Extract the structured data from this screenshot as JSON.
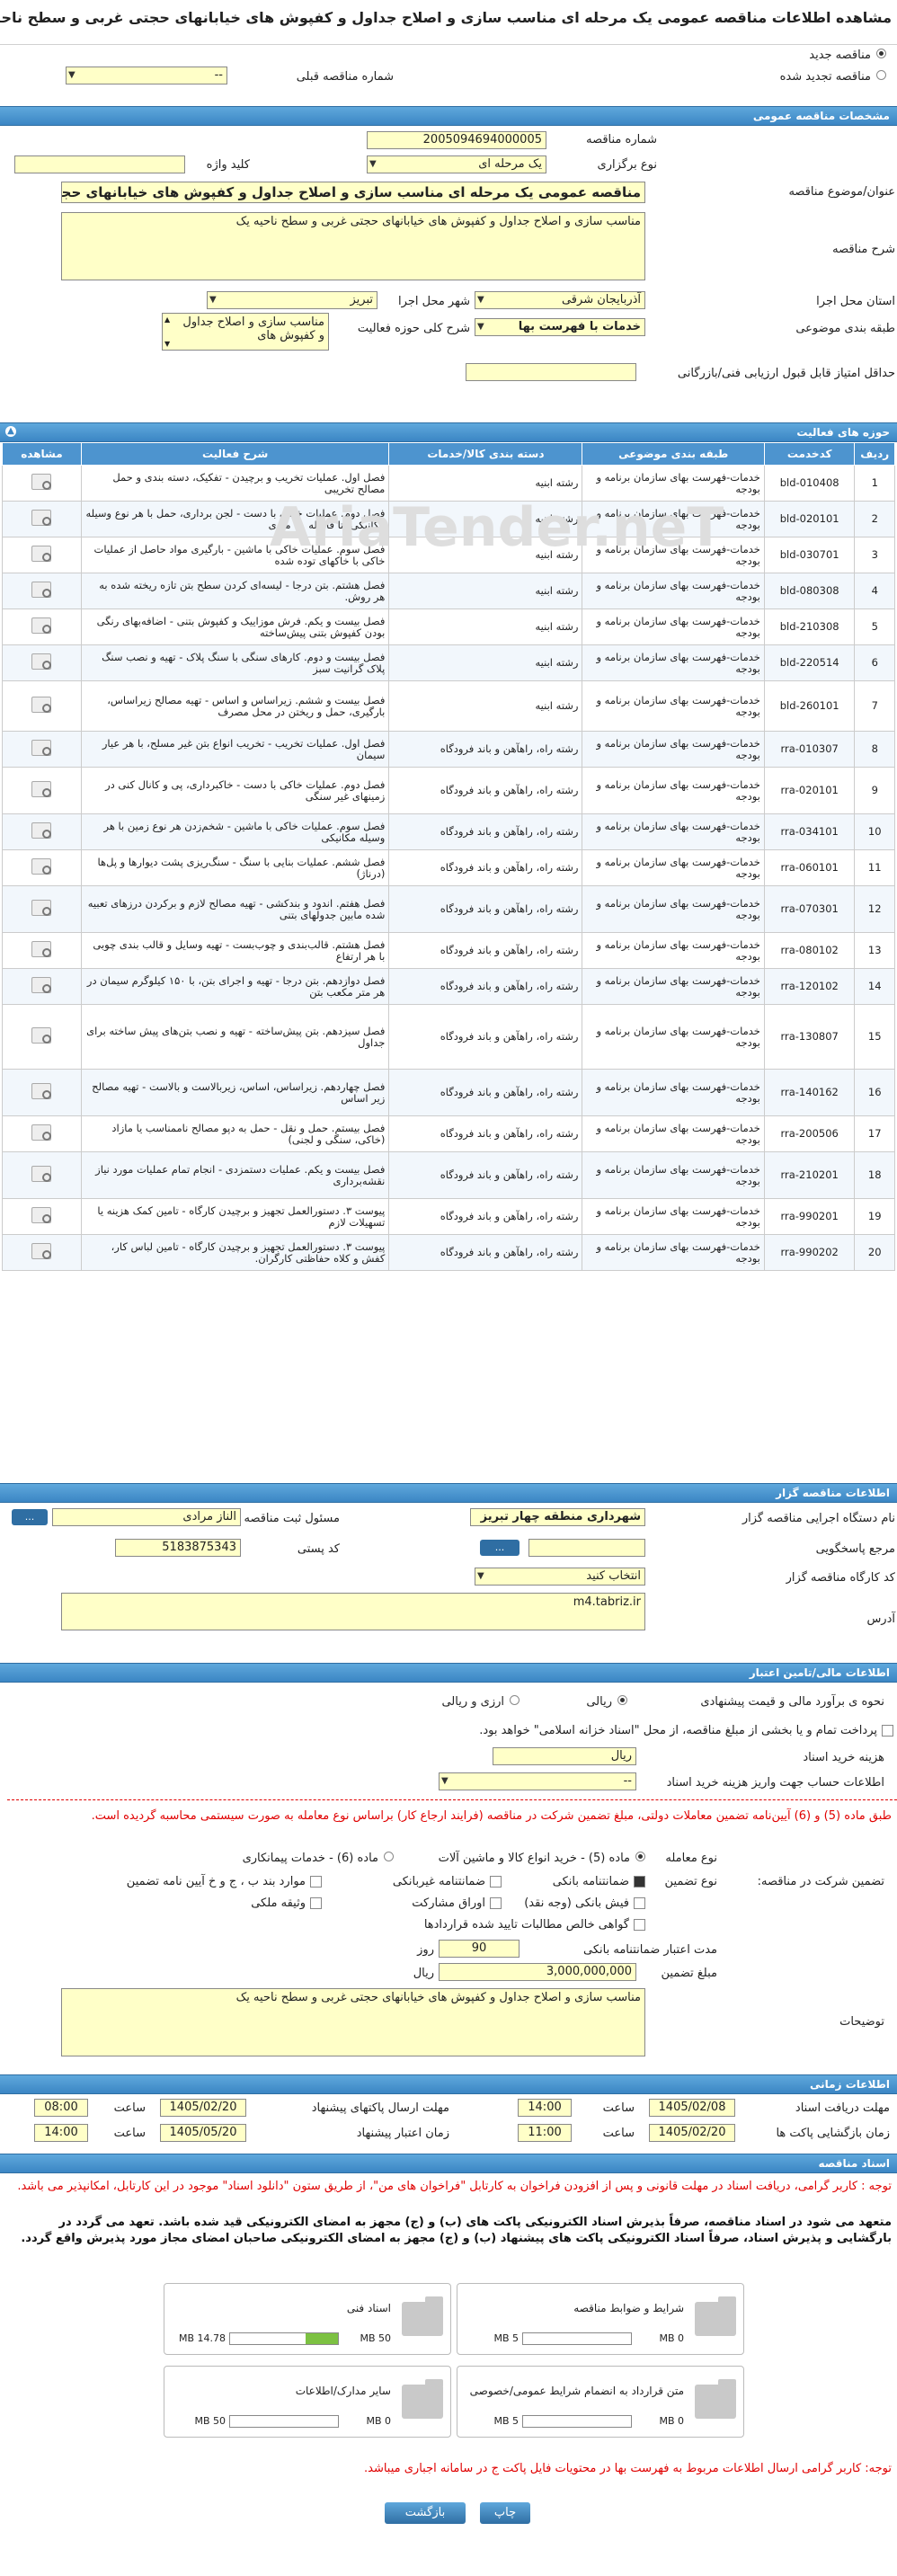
{
  "page": {
    "title": "مشاهده اطلاعات مناقصه عمومی یک مرحله ای مناسب سازی و اصلاح جداول و کفپوش های خیابانهای حجتی غربی و سطح ناحیه یک",
    "radio_new": "مناقصه جدید",
    "radio_renewed": "مناقصه تجدید شده",
    "prev_label": "شماره مناقصه قبلی",
    "prev_value": "--"
  },
  "specs": {
    "section": "مشخصات مناقصه عمومی",
    "number_label": "شماره مناقصه",
    "number_value": "2005094694000005",
    "type_label": "نوع برگزاری",
    "type_value": "یک مرحله ای",
    "keyword_label": "کلید واژه",
    "subject_label": "عنوان/موضوع مناقصه",
    "subject_value": "مناقصه عمومی یک مرحله ای مناسب سازی و اصلاح جداول و کفپوش های خیابانهای حجتی غربی و سطح ناحیه یک",
    "desc_label": "شرح مناقصه",
    "desc_value": "مناسب سازی و اصلاح جداول و کفپوش های خیابانهای حجتی غربی و سطح ناحیه یک",
    "province_label": "استان محل اجرا",
    "province_value": "آذربایجان شرقی",
    "city_label": "شهر محل اجرا",
    "city_value": "تبریز",
    "class_label": "طبقه بندی موضوعی",
    "class_value": "خدمات با فهرست بها",
    "scope_label": "شرح کلی حوزه فعالیت",
    "scope_value": "مناسب سازی و اصلاح جداول و کفپوش های",
    "score_label": "حداقل امتیاز قابل قبول ارزیابی فنی/بازرگانی"
  },
  "activities": {
    "section": "حوزه های فعالیت",
    "headers": [
      "ردیف",
      "کدخدمت",
      "طبقه بندی موضوعی",
      "دسته بندی کالا/خدمات",
      "شرح فعالیت",
      "مشاهده"
    ],
    "rows": [
      {
        "n": "1",
        "code": "bld-010408",
        "cat": "خدمات-فهرست بهای سازمان برنامه و بودجه",
        "grp": "رشته ابنیه",
        "desc": "فصل اول. عملیات تخریب و برچیدن - تفکیک، دسته بندی و حمل مصالح تخریبی"
      },
      {
        "n": "2",
        "code": "bld-020101",
        "cat": "خدمات-فهرست بهای سازمان برنامه و بودجه",
        "grp": "رشته ابنیه",
        "desc": "فصل دوم. عملیات خاکی با دست - لجن برداری، حمل با هر نوع وسیله مکانیکی، تا فاصله ۵۰ متری"
      },
      {
        "n": "3",
        "code": "bld-030701",
        "cat": "خدمات-فهرست بهای سازمان برنامه و بودجه",
        "grp": "رشته ابنیه",
        "desc": "فصل سوم. عملیات خاکی با ماشین - بارگیری مواد حاصل از عملیات خاکی با خاکهای توده شده"
      },
      {
        "n": "4",
        "code": "bld-080308",
        "cat": "خدمات-فهرست بهای سازمان برنامه و بودجه",
        "grp": "رشته ابنیه",
        "desc": "فصل هشتم. بتن درجا - لیسه‌ای کردن سطح بتن تازه ریخته شده به هر روش."
      },
      {
        "n": "5",
        "code": "bld-210308",
        "cat": "خدمات-فهرست بهای سازمان برنامه و بودجه",
        "grp": "رشته ابنیه",
        "desc": "فصل بیست و یکم. فرش موزاییک و کفپوش بتنی - اضافه‌بهای رنگی بودن کفپوش بتنی پیش‌ساخته"
      },
      {
        "n": "6",
        "code": "bld-220514",
        "cat": "خدمات-فهرست بهای سازمان برنامه و بودجه",
        "grp": "رشته ابنیه",
        "desc": "فصل بیست و دوم. کارهای سنگی با سنگ پلاک - تهیه و نصب سنگ پلاک گرانیت سبز"
      },
      {
        "n": "7",
        "code": "bld-260101",
        "cat": "خدمات-فهرست بهای سازمان برنامه و بودجه",
        "grp": "رشته ابنیه",
        "desc": "فصل بیست و ششم. زیراساس و اساس - تهیه مصالح زیراساس، بارگیری، حمل و ریختن در محل مصرف"
      },
      {
        "n": "8",
        "code": "rra-010307",
        "cat": "خدمات-فهرست بهای سازمان برنامه و بودجه",
        "grp": "رشته راه، راهآهن و باند فرودگاه",
        "desc": "فصل اول. عملیات تخریب - تخریب انواع بتن غیر مسلح، با هر عیار سیمان"
      },
      {
        "n": "9",
        "code": "rra-020101",
        "cat": "خدمات-فهرست بهای سازمان برنامه و بودجه",
        "grp": "رشته راه، راهآهن و باند فرودگاه",
        "desc": "فصل دوم. عملیات خاکی با دست - خاکبرداری، پی و کانال کنی در زمینهای غیر سنگی"
      },
      {
        "n": "10",
        "code": "rra-034101",
        "cat": "خدمات-فهرست بهای سازمان برنامه و بودجه",
        "grp": "رشته راه، راهآهن و باند فرودگاه",
        "desc": "فصل سوم. عملیات خاکی با ماشین - شخم‌زدن هر نوع زمین با هر وسیله مکانیکی"
      },
      {
        "n": "11",
        "code": "rra-060101",
        "cat": "خدمات-فهرست بهای سازمان برنامه و بودجه",
        "grp": "رشته راه، راهآهن و باند فرودگاه",
        "desc": "فصل ششم. عملیات بنایی با سنگ - سنگ‌ریزی پشت دیوارها و پل‌ها (درناژ)"
      },
      {
        "n": "12",
        "code": "rra-070301",
        "cat": "خدمات-فهرست بهای سازمان برنامه و بودجه",
        "grp": "رشته راه، راهآهن و باند فرودگاه",
        "desc": "فصل هفتم. اندود و بندکشی - تهیه مصالح لازم و برکردن درزهای تعبیه شده مابین جدولهای بتنی"
      },
      {
        "n": "13",
        "code": "rra-080102",
        "cat": "خدمات-فهرست بهای سازمان برنامه و بودجه",
        "grp": "رشته راه، راهآهن و باند فرودگاه",
        "desc": "فصل هشتم. قالب‌بندی و چوب‌بست - تهیه وسایل و قالب بندی چوبی با هر ارتفاع"
      },
      {
        "n": "14",
        "code": "rra-120102",
        "cat": "خدمات-فهرست بهای سازمان برنامه و بودجه",
        "grp": "رشته راه، راهآهن و باند فرودگاه",
        "desc": "فصل دوازدهم. بتن درجا - تهیه و اجرای بتن، با ۱۵۰ کیلوگرم سیمان در هر متر مکعب بتن"
      },
      {
        "n": "15",
        "code": "rra-130807",
        "cat": "خدمات-فهرست بهای سازمان برنامه و بودجه",
        "grp": "رشته راه، راهآهن و باند فرودگاه",
        "desc": "فصل سیزدهم. بتن پیش‌ساخته - تهیه و نصب بتن‌های پیش ساخته برای جداول"
      },
      {
        "n": "16",
        "code": "rra-140162",
        "cat": "خدمات-فهرست بهای سازمان برنامه و بودجه",
        "grp": "رشته راه، راهآهن و باند فرودگاه",
        "desc": "فصل چهاردهم. زیراساس، اساس، زیربالاست و بالاست - تهیه مصالح زیر اساس"
      },
      {
        "n": "17",
        "code": "rra-200506",
        "cat": "خدمات-فهرست بهای سازمان برنامه و بودجه",
        "grp": "رشته راه، راهآهن و باند فرودگاه",
        "desc": "فصل بیستم. حمل و نقل - حمل به دپو مصالح ناممناسب یا مازاد (خاکی، سنگی و لجنی)"
      },
      {
        "n": "18",
        "code": "rra-210201",
        "cat": "خدمات-فهرست بهای سازمان برنامه و بودجه",
        "grp": "رشته راه، راهآهن و باند فرودگاه",
        "desc": "فصل بیست و یکم. عملیات دستمزدی - انجام تمام عملیات مورد نیاز نقشه‌برداری"
      },
      {
        "n": "19",
        "code": "rra-990201",
        "cat": "خدمات-فهرست بهای سازمان برنامه و بودجه",
        "grp": "رشته راه، راهآهن و باند فرودگاه",
        "desc": "پیوست ۳. دستورالعمل تجهیز و برچیدن کارگاه - تامین کمک هزینه یا تسهیلات لازم"
      },
      {
        "n": "20",
        "code": "rra-990202",
        "cat": "خدمات-فهرست بهای سازمان برنامه و بودجه",
        "grp": "رشته راه، راهآهن و باند فرودگاه",
        "desc": "پیوست ۳. دستورالعمل تجهیز و برچیدن کارگاه - تامین لباس کار، کفش و کلاه حفاظتی کارگران."
      }
    ]
  },
  "org": {
    "section": "اطلاعات مناقصه گزار",
    "name_label": "نام دستگاه اجرایی مناقصه گزار",
    "name_value": "شهرداری منطقه چهار تبریز",
    "person_label": "مسئول ثبت مناقصه",
    "person_value": "الناز مرادی",
    "ref_label": "مرجع پاسخگویی",
    "postal_label": "کد پستی",
    "postal_value": "5183875343",
    "workshop_label": "کد کارگاه مناقصه گزار",
    "workshop_value": "انتخاب کنید",
    "address_label": "آدرس",
    "address_value": "m4.tabriz.ir",
    "btn_more": "...",
    "btn_dots": "..."
  },
  "finance": {
    "section": "اطلاعات مالی/تامین اعتبار",
    "estimate_label": "نحوه ی برآورد مالی و قیمت پیشنهادی",
    "opt_rial": "ریالی",
    "opt_fx": "ارزی و ریالی",
    "treasury_text": "پرداخت تمام و یا بخشی از مبلغ مناقصه، از محل \"اسناد خزانه اسلامی\" خواهد بود.",
    "doc_cost_label": "هزینه خرید اسناد",
    "doc_cost_unit": "ریال",
    "account_label": "اطلاعات حساب جهت واریز هزینه خرید اسناد",
    "account_value": "--",
    "notice_red": "طبق ماده (5) و (6) آیین‌نامه تضمین معاملات دولتی، مبلغ تضمین شرکت در مناقصه (فرایند ارجاع کار) براساس نوع معامله به صورت سیستمی محاسبه گردیده است.",
    "deal_type_label": "نوع معامله",
    "deal_opt1": "ماده (5) - خرید انواع کالا و ماشین آلات",
    "deal_opt2": "ماده (6) - خدمات پیمانکاری",
    "guarantee_label": "تضمین شرکت در مناقصه:",
    "guarantee_type_label": "نوع تضمین",
    "g_bank": "ضمانتنامه بانکی",
    "g_nonbank": "ضمانتنامه غیربانکی",
    "g_bond": "موارد بند ب ، ج و خ آیین نامه تضمین",
    "g_check": "فیش بانکی (وجه نقد)",
    "g_paper": "اوراق مشارکت",
    "g_property": "وثیقه ملکی",
    "g_cert": "گواهی خالص مطالبات تایید شده قراردادها",
    "validity_label": "مدت اعتبار ضمانتنامه بانکی",
    "validity_value": "90",
    "validity_unit": "روز",
    "amount_label": "مبلغ تضمین",
    "amount_value": "3,000,000,000",
    "amount_unit": "ریال",
    "notes_label": "توضیحات",
    "notes_value": "مناسب سازی و اصلاح جداول و کفپوش های خیابانهای حجتی غربی و سطح ناحیه یک"
  },
  "timing": {
    "section": "اطلاعات زمانی",
    "recv_label": "مهلت دریافت اسناد",
    "recv_date": "1405/02/08",
    "recv_time": "14:00",
    "send_label": "مهلت ارسال پاکتهای پیشنهاد",
    "send_date": "1405/02/20",
    "send_time": "08:00",
    "open_label": "زمان بازگشایی پاکت ها",
    "open_date": "1405/02/20",
    "open_time": "11:00",
    "valid_label": "زمان اعتبار پیشنهاد",
    "valid_date": "1405/05/20",
    "valid_time": "14:00",
    "time_word": "ساعت"
  },
  "docs": {
    "section": "اسناد مناقصه",
    "note1": "توجه : کاربر گرامی، دریافت اسناد در مهلت قانونی و پس از افزودن فراخوان به کارتابل \"فراخوان های من\"، از طریق ستون \"دانلود اسناد\" موجود در این کارتابل، امکانپذیر می باشد.",
    "note2": "متعهد می شود در اسناد مناقصه، صرفاً بذیرش اسناد الکترونیکی پاکت های (ب) و (ج) مجهز به امضای الکترونیکی قید شده باشد. تعهد می گردد در بارگشایی و پذیرش اسناد، صرفاً اسناد الکترونیکی پاکت های پیشنهاد (ب) و (ج) مجهز به امضای الکترونیکی صاحبان امضای مجاز مورد پذیرش واقع گردد.",
    "files": [
      {
        "name": "شرایط و ضوابط مناقصه",
        "size": "0 MB",
        "max": "5 MB",
        "fill": 0
      },
      {
        "name": "اسناد فنی",
        "size": "14.78 MB",
        "max": "50 MB",
        "fill": 0.296
      },
      {
        "name": "متن قرارداد به انضمام شرایط عمومی/خصوصی",
        "size": "0 MB",
        "max": "5 MB",
        "fill": 0
      },
      {
        "name": "سایر مدارک/اطلاعات",
        "size": "0 MB",
        "max": "50 MB",
        "fill": 0
      }
    ],
    "note3": "توجه: کاربر گرامی ارسال اطلاعات مربوط به فهرست بها در محتویات فایل پاکت ج در سامانه اجباری میباشد."
  },
  "buttons": {
    "print": "چاپ",
    "back": "بازگشت"
  },
  "watermark": "AriaTender.neT"
}
